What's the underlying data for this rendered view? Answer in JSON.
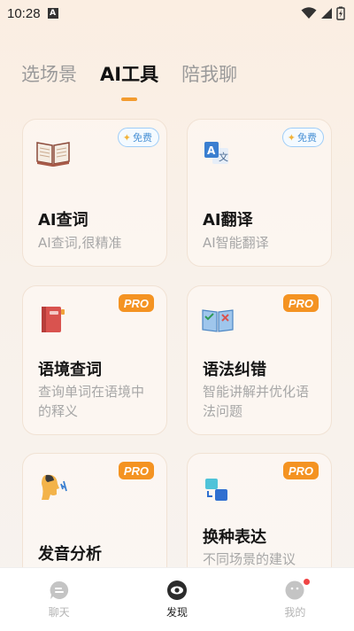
{
  "status": {
    "time": "10:28",
    "notif_letter": "A"
  },
  "tabs": [
    {
      "label": "选场景"
    },
    {
      "label": "AI工具"
    },
    {
      "label": "陪我聊"
    }
  ],
  "cards": [
    {
      "title": "AI查词",
      "desc": "AI查词,很精准",
      "badge": "免费"
    },
    {
      "title": "AI翻译",
      "desc": "AI智能翻译",
      "badge": "免费"
    },
    {
      "title": "语境查词",
      "desc": "查询单词在语境中的释义",
      "badge": "PRO"
    },
    {
      "title": "语法纠错",
      "desc": "智能讲解并优化语法问题",
      "badge": "PRO"
    },
    {
      "title": "发音分析",
      "desc": "",
      "badge": "PRO"
    },
    {
      "title": "换种表达",
      "desc": "不同场景的建议",
      "badge": "PRO"
    }
  ],
  "nav": [
    {
      "label": "聊天"
    },
    {
      "label": "发现"
    },
    {
      "label": "我的"
    }
  ],
  "colors": {
    "accent": "#f39b2f",
    "pro": "#f49322",
    "free_border": "#9fcdf7"
  }
}
